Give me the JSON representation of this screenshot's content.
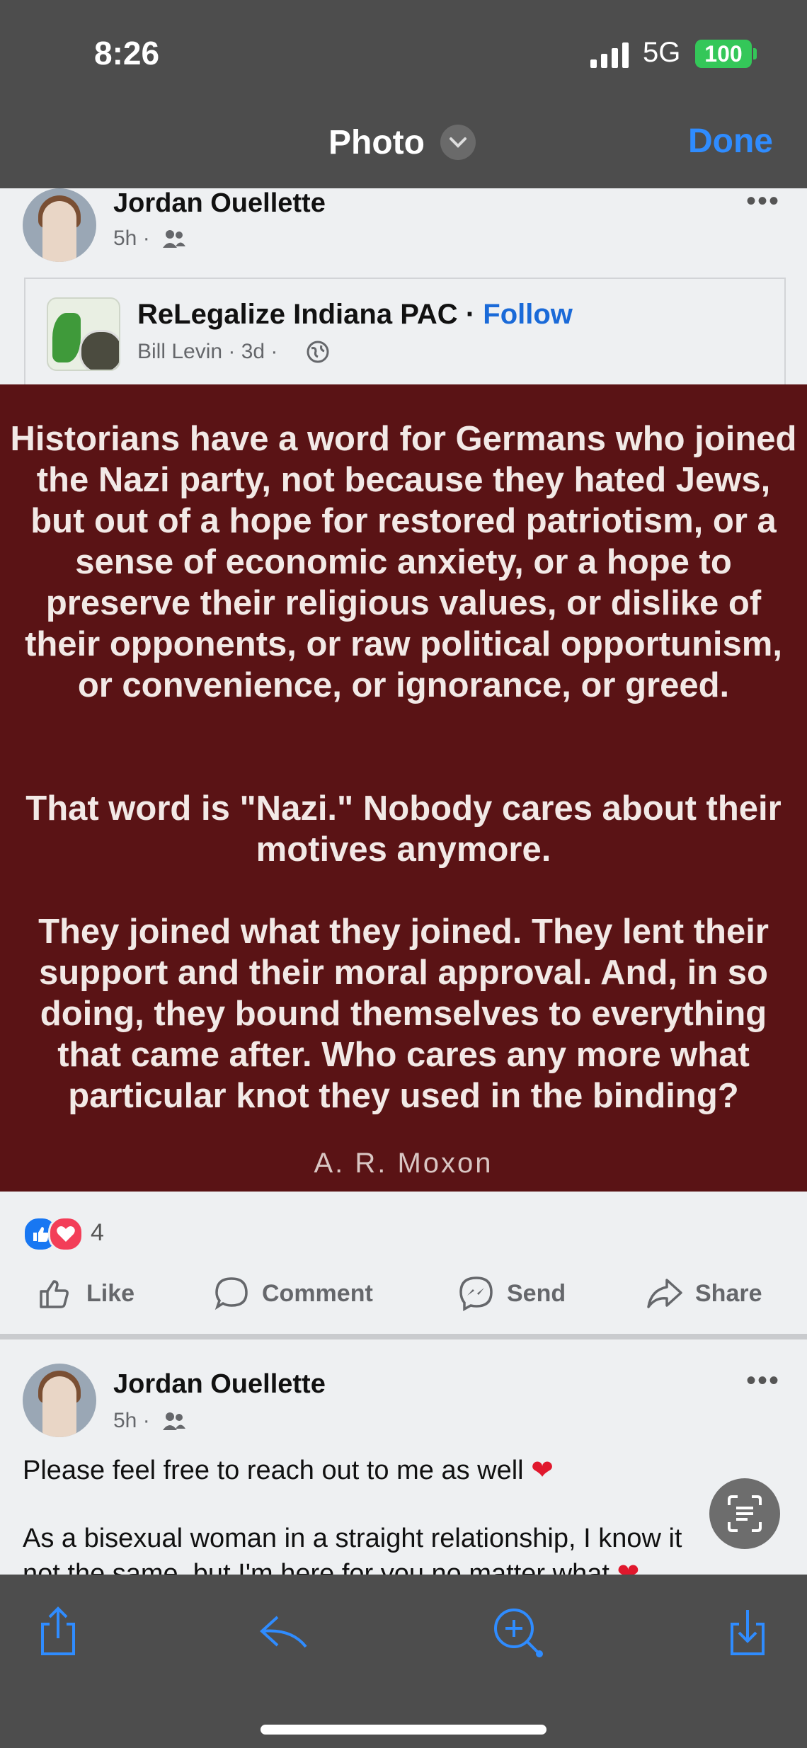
{
  "status": {
    "time": "8:26",
    "network": "5G",
    "battery": "100"
  },
  "nav": {
    "title": "Photo",
    "done": "Done"
  },
  "post1": {
    "author": "Jordan Ouellette",
    "time": "5h ·",
    "shared": {
      "page": "ReLegalize Indiana PAC",
      "sep": "·",
      "follow": "Follow",
      "byline": "Bill Levin · 3d ·"
    },
    "quote": {
      "p1": "Historians have a word for Germans who joined the Nazi party, not because they hated Jews, but out of a hope for restored patriotism, or a sense of economic anxiety, or a hope to preserve their religious values, or dislike of their opponents, or raw political opportunism, or convenience, or ignorance, or greed.",
      "p2": "That word is \"Nazi.\" Nobody cares about their motives anymore.",
      "p3": "They joined what they joined. They lent their support and their moral approval. And, in so doing, they bound themselves to everything that came after. Who cares any more what particular knot they used in the binding?",
      "author": "A. R. Moxon"
    },
    "reaction_count": "4",
    "actions": {
      "like": "Like",
      "comment": "Comment",
      "send": "Send",
      "share": "Share"
    }
  },
  "post2": {
    "author": "Jordan Ouellette",
    "time": "5h ·",
    "line1": "Please feel free to reach out to me as well",
    "line2": "As a bisexual woman in a straight relationship, I know it",
    "line3": "not the same, but I'm here for you no matter what"
  },
  "colors": {
    "accent": "#1877f2",
    "done": "#2f8cff",
    "quote_bg": "#5a1315",
    "battery": "#34c759"
  }
}
